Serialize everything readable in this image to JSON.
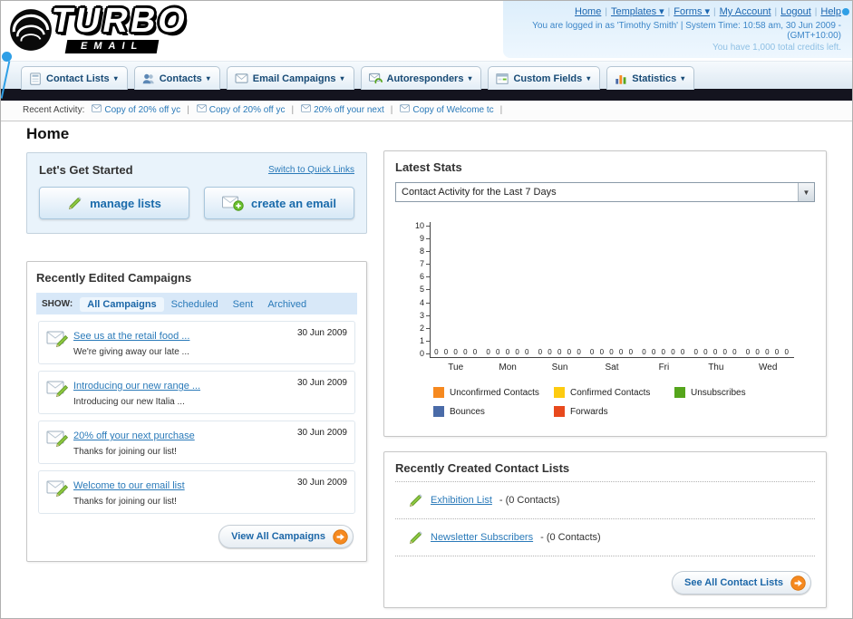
{
  "header": {
    "logo": {
      "title": "TURBO",
      "subtitle": "EMAIL",
      "icon": "swoosh-icon"
    },
    "nav_links": [
      {
        "label": "Home",
        "dropdown": false
      },
      {
        "label": "Templates",
        "dropdown": true
      },
      {
        "label": "Forms",
        "dropdown": true
      },
      {
        "label": "My Account",
        "dropdown": false
      },
      {
        "label": "Logout",
        "dropdown": false
      },
      {
        "label": "Help",
        "dropdown": false
      }
    ],
    "login_info": "You are logged in as 'Timothy Smith' | System Time: 10:58 am, 30 Jun 2009 - (GMT+10:00)",
    "credits_info": "You have 1,000 total credits left."
  },
  "main_nav": {
    "items": [
      {
        "label": "Contact Lists",
        "icon": "contact-lists-icon"
      },
      {
        "label": "Contacts",
        "icon": "contacts-icon"
      },
      {
        "label": "Email Campaigns",
        "icon": "email-campaigns-icon"
      },
      {
        "label": "Autoresponders",
        "icon": "autoresponders-icon"
      },
      {
        "label": "Custom Fields",
        "icon": "custom-fields-icon"
      },
      {
        "label": "Statistics",
        "icon": "statistics-icon"
      }
    ]
  },
  "recent_activity": {
    "label": "Recent Activity:",
    "items": [
      {
        "label": "Copy of 20% off yc",
        "icon": "email-icon"
      },
      {
        "label": "Copy of 20% off yc",
        "icon": "email-icon"
      },
      {
        "label": "20% off your next",
        "icon": "email-icon"
      },
      {
        "label": "Copy of Welcome tc",
        "icon": "email-icon"
      }
    ]
  },
  "page": {
    "title": "Home"
  },
  "get_started": {
    "title": "Let's Get Started",
    "switch_link": "Switch to Quick Links",
    "buttons": [
      {
        "label": "manage lists",
        "icon": "pencil-icon"
      },
      {
        "label": "create an email",
        "icon": "email-plus-icon"
      }
    ]
  },
  "campaigns": {
    "title": "Recently Edited Campaigns",
    "show_label": "SHOW:",
    "tabs": [
      "All Campaigns",
      "Scheduled",
      "Sent",
      "Archived"
    ],
    "active_tab": "All Campaigns",
    "rows": [
      {
        "title": "See us at the retail food ...",
        "subtitle": "We're giving away our late ...",
        "date": "30 Jun 2009",
        "icon": "email-pencil-icon"
      },
      {
        "title": "Introducing our new range ...",
        "subtitle": "Introducing our new Italia ...",
        "date": "30 Jun 2009",
        "icon": "email-pencil-icon"
      },
      {
        "title": "20% off your next purchase",
        "subtitle": "Thanks for joining our list!",
        "date": "30 Jun 2009",
        "icon": "email-pencil-icon"
      },
      {
        "title": "Welcome to our email list",
        "subtitle": "Thanks for joining our list!",
        "date": "30 Jun 2009",
        "icon": "email-pencil-icon"
      }
    ],
    "view_all_label": "View All Campaigns",
    "view_all_icon": "arrow-circle-icon"
  },
  "stats": {
    "title": "Latest Stats",
    "filter_value": "Contact Activity for the Last 7 Days",
    "dropdown_icon": "chevron-down-icon"
  },
  "chart_data": {
    "type": "bar",
    "title": "Contact Activity for the Last 7 Days",
    "categories": [
      "Tue",
      "Mon",
      "Sun",
      "Sat",
      "Fri",
      "Thu",
      "Wed"
    ],
    "series": [
      {
        "name": "Unconfirmed Contacts",
        "color": "#f6891f",
        "values": [
          0,
          0,
          0,
          0,
          0,
          0,
          0
        ]
      },
      {
        "name": "Confirmed Contacts",
        "color": "#fdcb10",
        "values": [
          0,
          0,
          0,
          0,
          0,
          0,
          0
        ]
      },
      {
        "name": "Unsubscribes",
        "color": "#55a51c",
        "values": [
          0,
          0,
          0,
          0,
          0,
          0,
          0
        ]
      },
      {
        "name": "Bounces",
        "color": "#4a6ba8",
        "values": [
          0,
          0,
          0,
          0,
          0,
          0,
          0
        ]
      },
      {
        "name": "Forwards",
        "color": "#e8491d",
        "values": [
          0,
          0,
          0,
          0,
          0,
          0,
          0
        ]
      }
    ],
    "ylim": [
      0,
      10
    ],
    "xlabel": "",
    "ylabel": "",
    "grid": false,
    "legend_position": "bottom"
  },
  "contact_lists": {
    "title": "Recently Created Contact Lists",
    "items": [
      {
        "name": "Exhibition List",
        "detail": "- (0 Contacts)",
        "icon": "pencil-icon"
      },
      {
        "name": "Newsletter Subscribers",
        "detail": "- (0 Contacts)",
        "icon": "pencil-icon"
      }
    ],
    "see_all_label": "See All Contact Lists",
    "see_all_icon": "arrow-circle-icon"
  }
}
